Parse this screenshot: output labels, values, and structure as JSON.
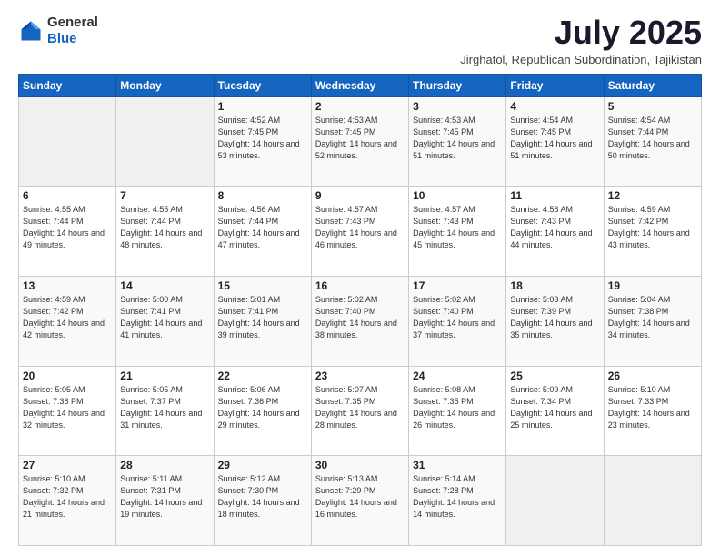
{
  "header": {
    "logo": {
      "general": "General",
      "blue": "Blue"
    },
    "title": "July 2025",
    "subtitle": "Jirghatol, Republican Subordination, Tajikistan"
  },
  "weekdays": [
    "Sunday",
    "Monday",
    "Tuesday",
    "Wednesday",
    "Thursday",
    "Friday",
    "Saturday"
  ],
  "weeks": [
    [
      {
        "day": "",
        "sunrise": "",
        "sunset": "",
        "daylight": ""
      },
      {
        "day": "",
        "sunrise": "",
        "sunset": "",
        "daylight": ""
      },
      {
        "day": "1",
        "sunrise": "Sunrise: 4:52 AM",
        "sunset": "Sunset: 7:45 PM",
        "daylight": "Daylight: 14 hours and 53 minutes."
      },
      {
        "day": "2",
        "sunrise": "Sunrise: 4:53 AM",
        "sunset": "Sunset: 7:45 PM",
        "daylight": "Daylight: 14 hours and 52 minutes."
      },
      {
        "day": "3",
        "sunrise": "Sunrise: 4:53 AM",
        "sunset": "Sunset: 7:45 PM",
        "daylight": "Daylight: 14 hours and 51 minutes."
      },
      {
        "day": "4",
        "sunrise": "Sunrise: 4:54 AM",
        "sunset": "Sunset: 7:45 PM",
        "daylight": "Daylight: 14 hours and 51 minutes."
      },
      {
        "day": "5",
        "sunrise": "Sunrise: 4:54 AM",
        "sunset": "Sunset: 7:44 PM",
        "daylight": "Daylight: 14 hours and 50 minutes."
      }
    ],
    [
      {
        "day": "6",
        "sunrise": "Sunrise: 4:55 AM",
        "sunset": "Sunset: 7:44 PM",
        "daylight": "Daylight: 14 hours and 49 minutes."
      },
      {
        "day": "7",
        "sunrise": "Sunrise: 4:55 AM",
        "sunset": "Sunset: 7:44 PM",
        "daylight": "Daylight: 14 hours and 48 minutes."
      },
      {
        "day": "8",
        "sunrise": "Sunrise: 4:56 AM",
        "sunset": "Sunset: 7:44 PM",
        "daylight": "Daylight: 14 hours and 47 minutes."
      },
      {
        "day": "9",
        "sunrise": "Sunrise: 4:57 AM",
        "sunset": "Sunset: 7:43 PM",
        "daylight": "Daylight: 14 hours and 46 minutes."
      },
      {
        "day": "10",
        "sunrise": "Sunrise: 4:57 AM",
        "sunset": "Sunset: 7:43 PM",
        "daylight": "Daylight: 14 hours and 45 minutes."
      },
      {
        "day": "11",
        "sunrise": "Sunrise: 4:58 AM",
        "sunset": "Sunset: 7:43 PM",
        "daylight": "Daylight: 14 hours and 44 minutes."
      },
      {
        "day": "12",
        "sunrise": "Sunrise: 4:59 AM",
        "sunset": "Sunset: 7:42 PM",
        "daylight": "Daylight: 14 hours and 43 minutes."
      }
    ],
    [
      {
        "day": "13",
        "sunrise": "Sunrise: 4:59 AM",
        "sunset": "Sunset: 7:42 PM",
        "daylight": "Daylight: 14 hours and 42 minutes."
      },
      {
        "day": "14",
        "sunrise": "Sunrise: 5:00 AM",
        "sunset": "Sunset: 7:41 PM",
        "daylight": "Daylight: 14 hours and 41 minutes."
      },
      {
        "day": "15",
        "sunrise": "Sunrise: 5:01 AM",
        "sunset": "Sunset: 7:41 PM",
        "daylight": "Daylight: 14 hours and 39 minutes."
      },
      {
        "day": "16",
        "sunrise": "Sunrise: 5:02 AM",
        "sunset": "Sunset: 7:40 PM",
        "daylight": "Daylight: 14 hours and 38 minutes."
      },
      {
        "day": "17",
        "sunrise": "Sunrise: 5:02 AM",
        "sunset": "Sunset: 7:40 PM",
        "daylight": "Daylight: 14 hours and 37 minutes."
      },
      {
        "day": "18",
        "sunrise": "Sunrise: 5:03 AM",
        "sunset": "Sunset: 7:39 PM",
        "daylight": "Daylight: 14 hours and 35 minutes."
      },
      {
        "day": "19",
        "sunrise": "Sunrise: 5:04 AM",
        "sunset": "Sunset: 7:38 PM",
        "daylight": "Daylight: 14 hours and 34 minutes."
      }
    ],
    [
      {
        "day": "20",
        "sunrise": "Sunrise: 5:05 AM",
        "sunset": "Sunset: 7:38 PM",
        "daylight": "Daylight: 14 hours and 32 minutes."
      },
      {
        "day": "21",
        "sunrise": "Sunrise: 5:05 AM",
        "sunset": "Sunset: 7:37 PM",
        "daylight": "Daylight: 14 hours and 31 minutes."
      },
      {
        "day": "22",
        "sunrise": "Sunrise: 5:06 AM",
        "sunset": "Sunset: 7:36 PM",
        "daylight": "Daylight: 14 hours and 29 minutes."
      },
      {
        "day": "23",
        "sunrise": "Sunrise: 5:07 AM",
        "sunset": "Sunset: 7:35 PM",
        "daylight": "Daylight: 14 hours and 28 minutes."
      },
      {
        "day": "24",
        "sunrise": "Sunrise: 5:08 AM",
        "sunset": "Sunset: 7:35 PM",
        "daylight": "Daylight: 14 hours and 26 minutes."
      },
      {
        "day": "25",
        "sunrise": "Sunrise: 5:09 AM",
        "sunset": "Sunset: 7:34 PM",
        "daylight": "Daylight: 14 hours and 25 minutes."
      },
      {
        "day": "26",
        "sunrise": "Sunrise: 5:10 AM",
        "sunset": "Sunset: 7:33 PM",
        "daylight": "Daylight: 14 hours and 23 minutes."
      }
    ],
    [
      {
        "day": "27",
        "sunrise": "Sunrise: 5:10 AM",
        "sunset": "Sunset: 7:32 PM",
        "daylight": "Daylight: 14 hours and 21 minutes."
      },
      {
        "day": "28",
        "sunrise": "Sunrise: 5:11 AM",
        "sunset": "Sunset: 7:31 PM",
        "daylight": "Daylight: 14 hours and 19 minutes."
      },
      {
        "day": "29",
        "sunrise": "Sunrise: 5:12 AM",
        "sunset": "Sunset: 7:30 PM",
        "daylight": "Daylight: 14 hours and 18 minutes."
      },
      {
        "day": "30",
        "sunrise": "Sunrise: 5:13 AM",
        "sunset": "Sunset: 7:29 PM",
        "daylight": "Daylight: 14 hours and 16 minutes."
      },
      {
        "day": "31",
        "sunrise": "Sunrise: 5:14 AM",
        "sunset": "Sunset: 7:28 PM",
        "daylight": "Daylight: 14 hours and 14 minutes."
      },
      {
        "day": "",
        "sunrise": "",
        "sunset": "",
        "daylight": ""
      },
      {
        "day": "",
        "sunrise": "",
        "sunset": "",
        "daylight": ""
      }
    ]
  ]
}
